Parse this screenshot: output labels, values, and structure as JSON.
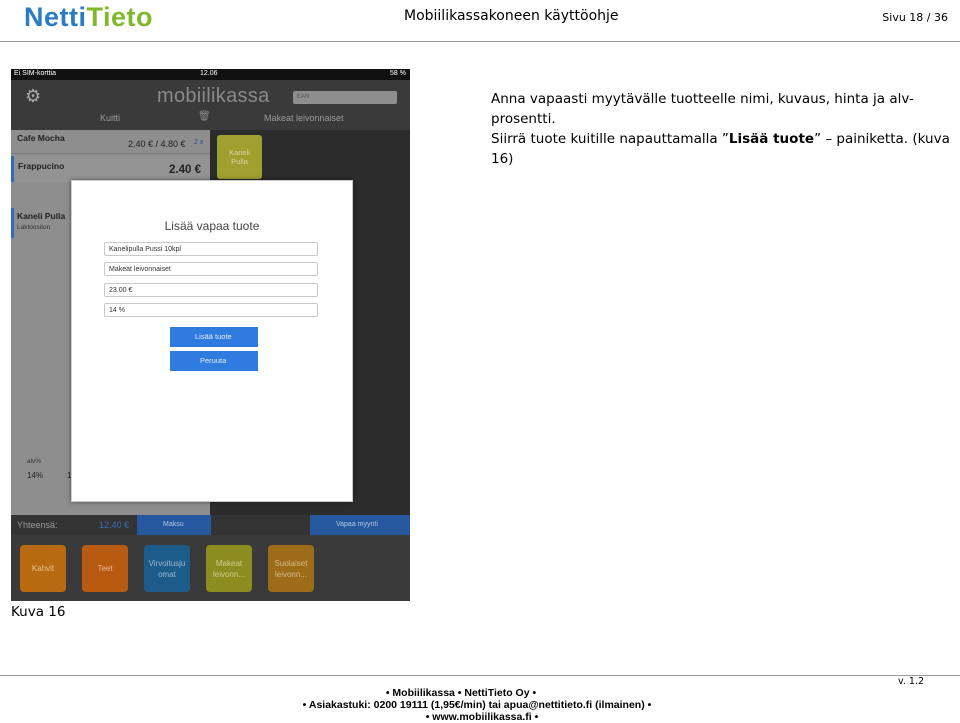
{
  "header": {
    "logo_part1": "Netti",
    "logo_part2": "Tieto",
    "doc_title": "Mobiilikassakoneen käyttöohje",
    "page_label": "Sivu 18 / 36"
  },
  "instructions": {
    "line1": "Anna vapaasti myytävälle tuotteelle nimi, kuvaus, hinta ja alv-prosentti.",
    "line2_pre": "Siirrä tuote kuitille napauttamalla ”",
    "line2_bold": "Lisää tuote",
    "line2_post": "” – painiketta. (kuva 16)"
  },
  "caption": "Kuva 16",
  "screenshot": {
    "status": {
      "carrier": "Ei SIM-korttia",
      "time": "12.06",
      "battery": "58 %"
    },
    "app_logo": "mobiilikassa",
    "ean_placeholder": "EAN",
    "receipt_label": "Kuitti",
    "category_title": "Makeat leivonnaiset",
    "receipt_rows": [
      {
        "name": "Cafe Mocha",
        "price": "2.40 € / 4.80 €",
        "qty": "2 x"
      },
      {
        "name": "Frappucino",
        "price": "2.40 €"
      },
      {
        "name": "Kaneli Pulla",
        "sub": "Laktoositon"
      }
    ],
    "product_tile": "Kaneli\nPulla",
    "vat_header": "alv%",
    "vat_value": "14%",
    "vat_value2": "1",
    "total_label": "Yhteensä:",
    "total_value": "12.40 €",
    "pay_button": "Maksu",
    "free_sale_button": "Vapaa myynti",
    "categories": [
      "Kahvit",
      "Teet",
      "Virvoitusju\nomat",
      "Makeat\nleivonn...",
      "Suolaiset\nleivonn..."
    ],
    "modal": {
      "title": "Lisää vapaa tuote",
      "name_value": "Kanelipulla Pussi 10kpl",
      "desc_value": "Makeat leivonnaiset",
      "price_value": "23.00 €",
      "vat_value": "14 %",
      "add_button": "Lisää tuote",
      "cancel_button": "Peruuta"
    }
  },
  "footer": {
    "version": "v. 1.2",
    "line1": "•  Mobiilikassa  •  NettiTieto Oy  •",
    "line2": "•  Asiakastuki: 0200 19111 (1,95€/min)  tai  apua@nettitieto.fi (ilmainen)  •",
    "line3": "•  www.mobiilikassa.fi  •"
  }
}
